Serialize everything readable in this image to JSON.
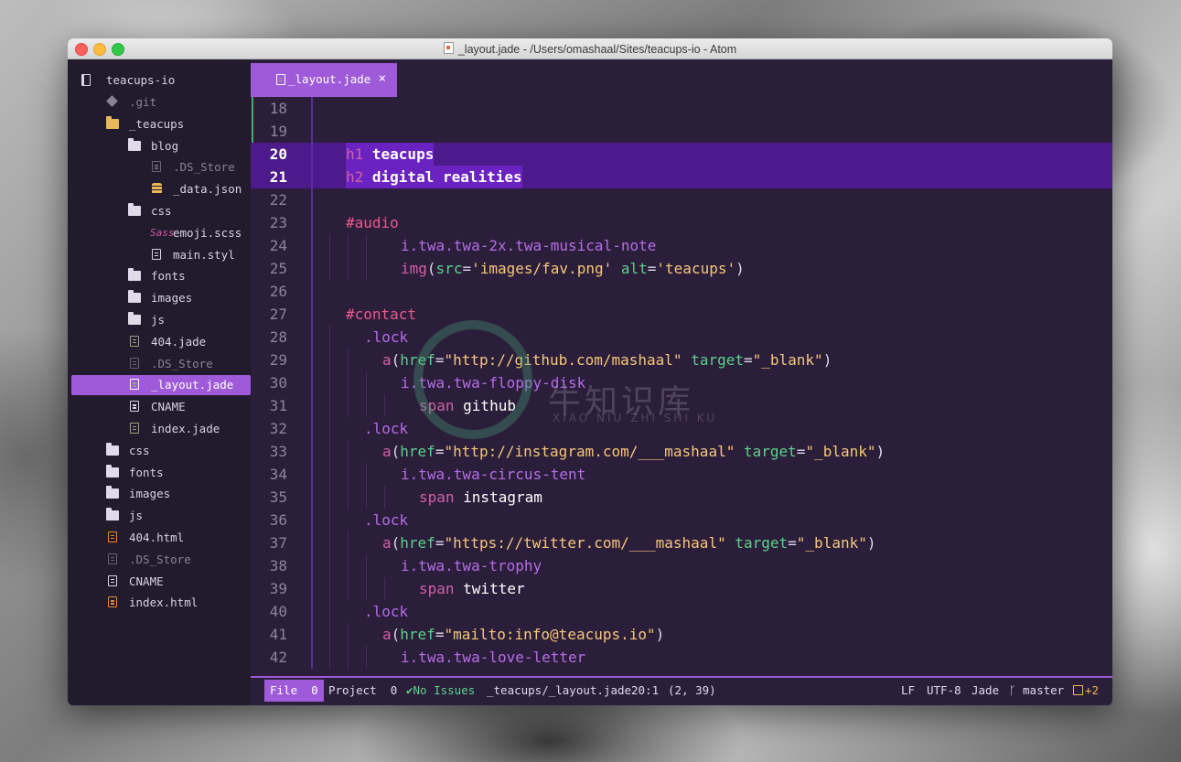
{
  "window": {
    "title": "_layout.jade - /Users/omashaal/Sites/teacups-io - Atom"
  },
  "sidebar": {
    "project": "teacups-io",
    "items": [
      {
        "label": ".git",
        "icon": "git-icon",
        "level": 1,
        "dim": true
      },
      {
        "label": "_teacups",
        "icon": "folder-icon",
        "level": 1,
        "gold": true
      },
      {
        "label": "blog",
        "icon": "folder-icon",
        "level": 2
      },
      {
        "label": ".DS_Store",
        "icon": "file-icon",
        "level": 3,
        "dim": true
      },
      {
        "label": "_data.json",
        "icon": "database-icon",
        "level": 3
      },
      {
        "label": "css",
        "icon": "folder-icon",
        "level": 2
      },
      {
        "label": "emoji.scss",
        "icon": "sass-icon",
        "level": 3
      },
      {
        "label": "main.styl",
        "icon": "file-icon",
        "level": 3
      },
      {
        "label": "fonts",
        "icon": "folder-icon",
        "level": 2
      },
      {
        "label": "images",
        "icon": "folder-icon",
        "level": 2
      },
      {
        "label": "js",
        "icon": "folder-icon",
        "level": 2
      },
      {
        "label": "404.jade",
        "icon": "jade-icon",
        "level": 2
      },
      {
        "label": ".DS_Store",
        "icon": "file-icon",
        "level": 2,
        "dim": true
      },
      {
        "label": "_layout.jade",
        "icon": "jade-icon",
        "level": 2,
        "selected": true
      },
      {
        "label": "CNAME",
        "icon": "file-icon",
        "level": 2
      },
      {
        "label": "index.jade",
        "icon": "jade-icon",
        "level": 2
      },
      {
        "label": "css",
        "icon": "folder-icon",
        "level": 1
      },
      {
        "label": "fonts",
        "icon": "folder-icon",
        "level": 1
      },
      {
        "label": "images",
        "icon": "folder-icon",
        "level": 1
      },
      {
        "label": "js",
        "icon": "folder-icon",
        "level": 1
      },
      {
        "label": "404.html",
        "icon": "html-icon",
        "level": 1
      },
      {
        "label": ".DS_Store",
        "icon": "file-icon",
        "level": 1,
        "dim": true
      },
      {
        "label": "CNAME",
        "icon": "file-icon",
        "level": 1
      },
      {
        "label": "index.html",
        "icon": "html-icon",
        "level": 1
      }
    ]
  },
  "tab": {
    "label": "_layout.jade",
    "close": "×"
  },
  "code": {
    "lines": [
      {
        "n": "18",
        "parts": []
      },
      {
        "n": "19",
        "parts": []
      },
      {
        "n": "20",
        "hl": true,
        "indent": 2,
        "parts": [
          [
            "tag",
            "h1"
          ],
          [
            "txt",
            " teacups"
          ]
        ]
      },
      {
        "n": "21",
        "hl": true,
        "indent": 2,
        "parts": [
          [
            "tag",
            "h2"
          ],
          [
            "txt",
            " digital realities"
          ]
        ]
      },
      {
        "n": "22",
        "parts": []
      },
      {
        "n": "23",
        "indent": 2,
        "parts": [
          [
            "id",
            "#audio"
          ]
        ]
      },
      {
        "n": "24",
        "indent": 5,
        "parts": [
          [
            "cls",
            "i.twa.twa-2x.twa-musical-note"
          ]
        ]
      },
      {
        "n": "25",
        "indent": 5,
        "parts": [
          [
            "tag",
            "img"
          ],
          [
            "pun",
            "("
          ],
          [
            "attr",
            "src"
          ],
          [
            "pun",
            "="
          ],
          [
            "str",
            "'images/fav.png'"
          ],
          [
            "pun",
            " "
          ],
          [
            "attr",
            "alt"
          ],
          [
            "pun",
            "="
          ],
          [
            "str",
            "'teacups'"
          ],
          [
            "pun",
            ")"
          ]
        ]
      },
      {
        "n": "26",
        "parts": []
      },
      {
        "n": "27",
        "indent": 2,
        "parts": [
          [
            "id",
            "#contact"
          ]
        ]
      },
      {
        "n": "28",
        "indent": 3,
        "parts": [
          [
            "cls",
            ".lock"
          ]
        ]
      },
      {
        "n": "29",
        "indent": 4,
        "parts": [
          [
            "tag",
            "a"
          ],
          [
            "pun",
            "("
          ],
          [
            "attr",
            "href"
          ],
          [
            "pun",
            "="
          ],
          [
            "str",
            "\"http://github.com/mashaal\""
          ],
          [
            "pun",
            " "
          ],
          [
            "attr",
            "target"
          ],
          [
            "pun",
            "="
          ],
          [
            "str",
            "\"_blank\""
          ],
          [
            "pun",
            ")"
          ]
        ]
      },
      {
        "n": "30",
        "indent": 5,
        "parts": [
          [
            "cls",
            "i.twa.twa-floppy-disk"
          ]
        ]
      },
      {
        "n": "31",
        "indent": 6,
        "parts": [
          [
            "tag",
            "span"
          ],
          [
            "txt",
            " github"
          ]
        ]
      },
      {
        "n": "32",
        "indent": 3,
        "parts": [
          [
            "cls",
            ".lock"
          ]
        ]
      },
      {
        "n": "33",
        "indent": 4,
        "parts": [
          [
            "tag",
            "a"
          ],
          [
            "pun",
            "("
          ],
          [
            "attr",
            "href"
          ],
          [
            "pun",
            "="
          ],
          [
            "str",
            "\"http://instagram.com/___mashaal\""
          ],
          [
            "pun",
            " "
          ],
          [
            "attr",
            "target"
          ],
          [
            "pun",
            "="
          ],
          [
            "str",
            "\"_blank\""
          ],
          [
            "pun",
            ")"
          ]
        ]
      },
      {
        "n": "34",
        "indent": 5,
        "parts": [
          [
            "cls",
            "i.twa.twa-circus-tent"
          ]
        ]
      },
      {
        "n": "35",
        "indent": 6,
        "parts": [
          [
            "tag",
            "span"
          ],
          [
            "txt",
            " instagram"
          ]
        ]
      },
      {
        "n": "36",
        "indent": 3,
        "parts": [
          [
            "cls",
            ".lock"
          ]
        ]
      },
      {
        "n": "37",
        "indent": 4,
        "parts": [
          [
            "tag",
            "a"
          ],
          [
            "pun",
            "("
          ],
          [
            "attr",
            "href"
          ],
          [
            "pun",
            "="
          ],
          [
            "str",
            "\"https://twitter.com/___mashaal\""
          ],
          [
            "pun",
            " "
          ],
          [
            "attr",
            "target"
          ],
          [
            "pun",
            "="
          ],
          [
            "str",
            "\"_blank\""
          ],
          [
            "pun",
            ")"
          ]
        ]
      },
      {
        "n": "38",
        "indent": 5,
        "parts": [
          [
            "cls",
            "i.twa.twa-trophy"
          ]
        ]
      },
      {
        "n": "39",
        "indent": 6,
        "parts": [
          [
            "tag",
            "span"
          ],
          [
            "txt",
            " twitter"
          ]
        ]
      },
      {
        "n": "40",
        "indent": 3,
        "parts": [
          [
            "cls",
            ".lock"
          ]
        ]
      },
      {
        "n": "41",
        "indent": 4,
        "parts": [
          [
            "tag",
            "a"
          ],
          [
            "pun",
            "("
          ],
          [
            "attr",
            "href"
          ],
          [
            "pun",
            "="
          ],
          [
            "str",
            "\"mailto:info@teacups.io\""
          ],
          [
            "pun",
            ")"
          ]
        ]
      },
      {
        "n": "42",
        "indent": 5,
        "parts": [
          [
            "cls",
            "i.twa.twa-love-letter"
          ]
        ]
      }
    ]
  },
  "status": {
    "file": "File",
    "file_count": "0",
    "project": "Project",
    "project_count": "0",
    "issues": "No Issues",
    "path": "_teacups/_layout.jade",
    "cursor": "20:1",
    "selection": "(2, 39)",
    "line_ending": "LF",
    "encoding": "UTF-8",
    "grammar": "Jade",
    "branch": "master",
    "git_changes": "+2"
  },
  "watermark": {
    "text": "牛知识库",
    "sub": "XIAO NIU ZHI SHI KU"
  },
  "colors": {
    "accent": "#9e5ad8",
    "editor_bg": "#2b1e3a",
    "sidebar_bg": "#221a2d",
    "highlight": "#4c1a8a",
    "tag": "#d262a3",
    "attr": "#5bd38a",
    "string": "#f6c77a",
    "class": "#b46ee6"
  }
}
